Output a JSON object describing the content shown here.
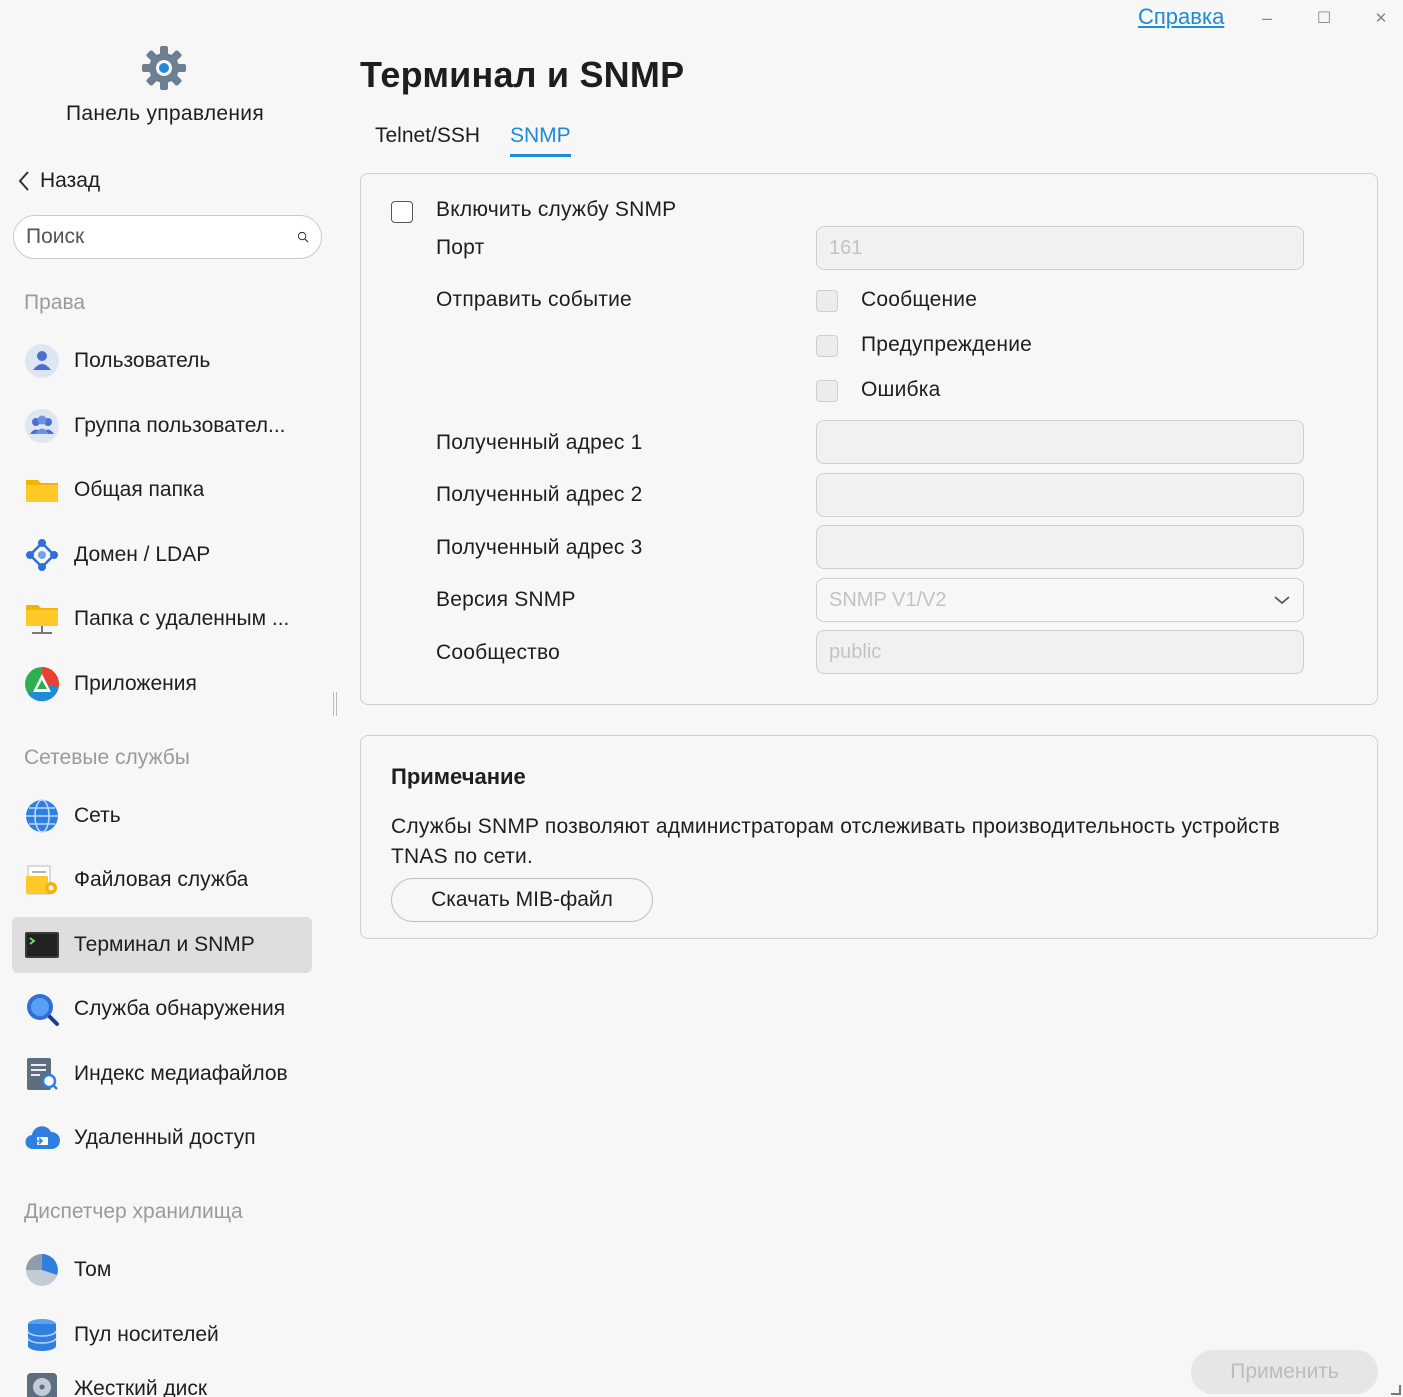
{
  "window": {
    "help_link": "Справка",
    "minimize": "–",
    "maximize": "☐",
    "close": "✕"
  },
  "sidebar": {
    "app_title": "Панель управления",
    "back_label": "Назад",
    "search_placeholder": "Поиск",
    "sections": [
      {
        "title": "Права",
        "items": [
          {
            "label": "Пользователь",
            "icon": "user-icon"
          },
          {
            "label": "Группа пользовател...",
            "icon": "user-group-icon"
          },
          {
            "label": "Общая папка",
            "icon": "shared-folder-icon"
          },
          {
            "label": "Домен / LDAP",
            "icon": "domain-ldap-icon"
          },
          {
            "label": "Папка с удаленным ...",
            "icon": "remote-folder-icon"
          },
          {
            "label": "Приложения",
            "icon": "applications-icon"
          }
        ]
      },
      {
        "title": "Сетевые службы",
        "items": [
          {
            "label": "Сеть",
            "icon": "network-globe-icon"
          },
          {
            "label": "Файловая служба",
            "icon": "file-service-icon"
          },
          {
            "label": "Терминал и SNMP",
            "icon": "terminal-icon",
            "active": true
          },
          {
            "label": "Служба обнаружения",
            "icon": "discovery-search-icon"
          },
          {
            "label": "Индекс медиафайлов",
            "icon": "media-index-icon"
          },
          {
            "label": "Удаленный доступ",
            "icon": "remote-access-cloud-icon"
          }
        ]
      },
      {
        "title": "Диспетчер хранилища",
        "items": [
          {
            "label": "Том",
            "icon": "volume-pie-icon"
          },
          {
            "label": "Пул носителей",
            "icon": "storage-pool-icon"
          },
          {
            "label": "Жесткий диск",
            "icon": "hard-disk-icon"
          }
        ]
      }
    ]
  },
  "main": {
    "title": "Терминал и SNMP",
    "tabs": [
      {
        "label": "Telnet/SSH",
        "active": false
      },
      {
        "label": "SNMP",
        "active": true
      }
    ],
    "snmp_form": {
      "enable_label": "Включить службу SNMP",
      "port_label": "Порт",
      "port_placeholder": "161",
      "send_event_label": "Отправить событие",
      "event_options": [
        "Сообщение",
        "Предупреждение",
        "Ошибка"
      ],
      "address1_label": "Полученный адрес 1",
      "address2_label": "Полученный адрес 2",
      "address3_label": "Полученный адрес 3",
      "version_label": "Версия SNMP",
      "version_value": "SNMP V1/V2",
      "community_label": "Сообщество",
      "community_placeholder": "public"
    },
    "note": {
      "title": "Примечание",
      "text": "Службы SNMP позволяют администраторам отслеживать производительность устройств TNAS по сети.",
      "download_button": "Скачать MIB-файл"
    },
    "apply_button": "Применить"
  },
  "colors": {
    "accent": "#1f8ad6",
    "background": "#f7f7f7",
    "active_item": "#dedede"
  }
}
